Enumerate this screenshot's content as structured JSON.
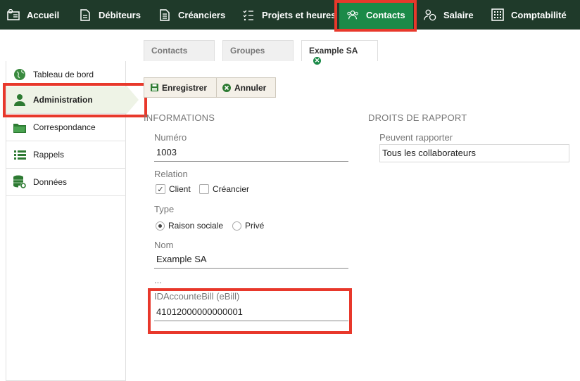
{
  "nav": {
    "items": [
      {
        "label": "Accueil",
        "icon": "home-settings-icon"
      },
      {
        "label": "Débiteurs",
        "icon": "document-icon"
      },
      {
        "label": "Créanciers",
        "icon": "document-list-icon"
      },
      {
        "label": "Projets et heures",
        "icon": "checklist-icon"
      },
      {
        "label": "Contacts",
        "icon": "people-icon"
      },
      {
        "label": "Salaire",
        "icon": "person-money-icon"
      },
      {
        "label": "Comptabilité",
        "icon": "calculator-icon"
      }
    ],
    "active": "Contacts"
  },
  "tabs": [
    {
      "label": "Contacts"
    },
    {
      "label": "Groupes"
    },
    {
      "label": "Example SA",
      "closable": true
    }
  ],
  "sidebar": {
    "items": [
      {
        "label": "Tableau de bord",
        "icon": "globe-icon"
      },
      {
        "label": "Administration",
        "icon": "person-icon"
      },
      {
        "label": "Correspondance",
        "icon": "folder-icon"
      },
      {
        "label": "Rappels",
        "icon": "list-icon"
      },
      {
        "label": "Données",
        "icon": "database-settings-icon"
      }
    ],
    "active": "Administration"
  },
  "toolbar": {
    "save_label": "Enregistrer",
    "cancel_label": "Annuler"
  },
  "informations": {
    "title": "INFORMATIONS",
    "numero_label": "Numéro",
    "numero_value": "1003",
    "relation_label": "Relation",
    "relation_client": "Client",
    "relation_client_checked": true,
    "relation_creancier": "Créancier",
    "relation_creancier_checked": false,
    "type_label": "Type",
    "type_option1": "Raison sociale",
    "type_option2": "Privé",
    "type_selected": "Raison sociale",
    "nom_label": "Nom",
    "nom_value": "Example SA",
    "ellipsis": "...",
    "ebill_label": "IDAccounteBill (eBill)",
    "ebill_value": "41012000000000001"
  },
  "droits": {
    "title": "DROITS DE RAPPORT",
    "label": "Peuvent rapporter",
    "value": "Tous les collaborateurs"
  },
  "colors": {
    "nav_bg": "#1f3a2a",
    "nav_active": "#1b8a48",
    "highlight": "#e8382b"
  }
}
